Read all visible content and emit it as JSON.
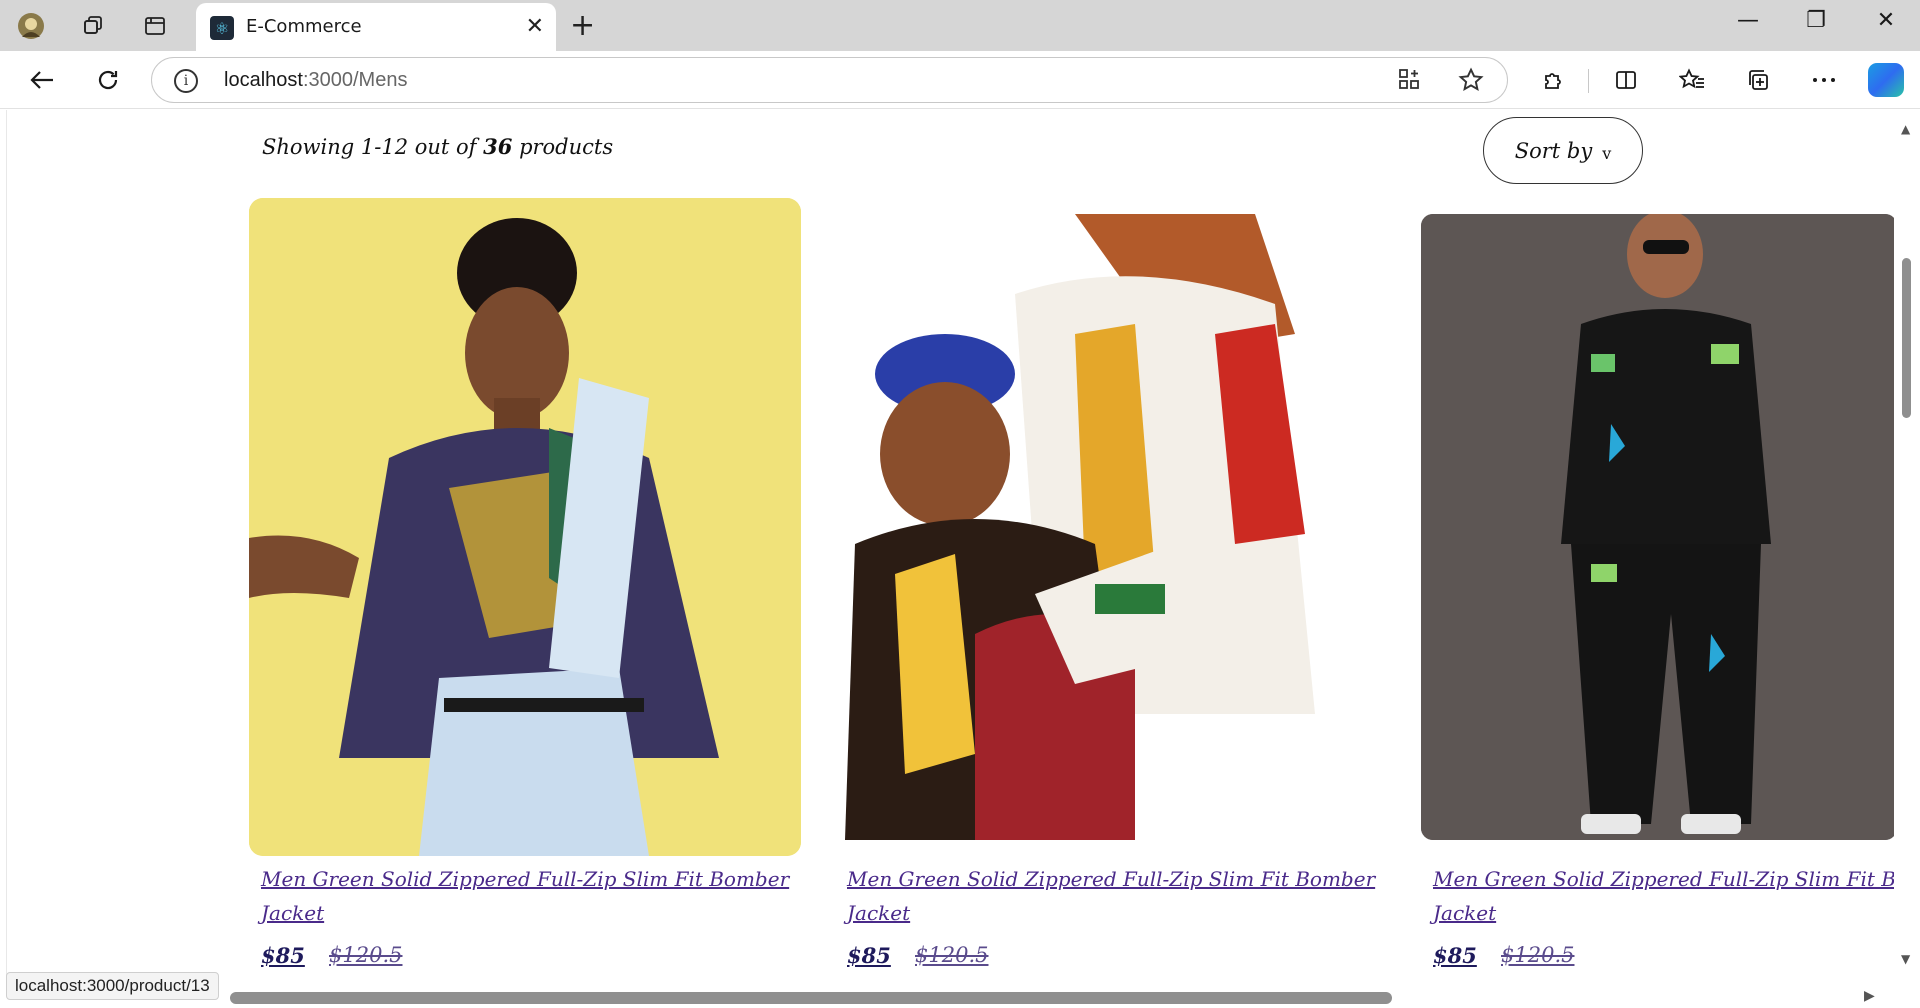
{
  "browser": {
    "tab": {
      "title": "E-Commerce",
      "close": "✕"
    },
    "new_tab": "+",
    "window_controls": {
      "minimize": "—",
      "restore": "❐",
      "close": "✕"
    },
    "address": {
      "host": "localhost",
      "path": ":3000/Mens"
    },
    "status_url": "localhost:3000/product/13"
  },
  "listing": {
    "showing_prefix": "Showing 1-12 out of",
    "total": "36",
    "showing_suffix": "products",
    "sort_label": "Sort by",
    "sort_chevron": "v"
  },
  "products": [
    {
      "title": "Men Green Solid Zippered Full-Zip Slim Fit Bomber Jacket",
      "price": "$85",
      "old_price": "$120.5"
    },
    {
      "title": "Men Green Solid Zippered Full-Zip Slim Fit Bomber Jacket",
      "price": "$85",
      "old_price": "$120.5"
    },
    {
      "title": "Men Green Solid Zippered Full-Zip Slim Fit Bomber Jacket",
      "price": "$85",
      "old_price": "$120.5"
    }
  ],
  "icons": {
    "profile": "profile-icon",
    "workspaces": "workspaces-icon",
    "tab_actions": "tab-actions-icon",
    "back": "back-arrow-icon",
    "refresh": "refresh-icon",
    "info": "info-icon",
    "app_install": "app-install-icon",
    "favorite": "star-icon",
    "extensions": "puzzle-icon",
    "split_screen": "split-screen-icon",
    "favorites": "favorites-icon",
    "collections": "collections-icon",
    "more": "more-icon",
    "copilot": "copilot-icon"
  },
  "colors": {
    "link": "#4a2a8a",
    "price": "#1e1a5c",
    "card1_bg": "#f0e27a",
    "card3_bg": "#5d5654"
  }
}
